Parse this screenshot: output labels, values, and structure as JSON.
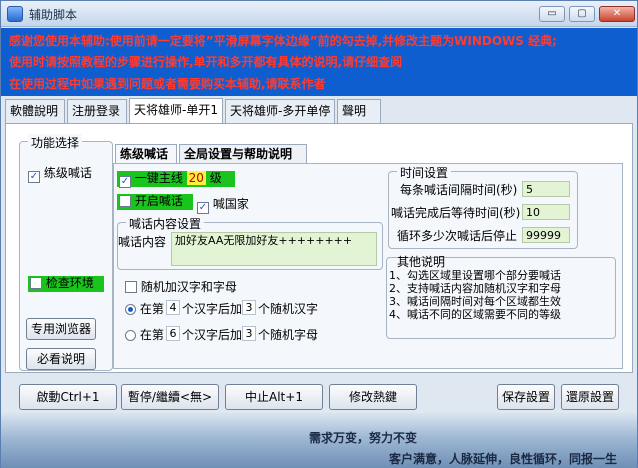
{
  "window": {
    "title": "辅助脚本",
    "controls": {
      "minimize": "▭",
      "restore": "▢",
      "close": "✕"
    }
  },
  "notice": {
    "lines": [
      "感谢您使用本辅助:使用前请一定要将”平滑屏幕字体边缘”前的勾去掉,并修改主题为WINDOWS 经典;",
      "使用时请按照教程的步骤进行操作,单开和多开都有具体的说明,请仔细查阅",
      "在使用过程中如果遇到问题或者需要购买本辅助,请联系作者"
    ],
    "color": "#ff3b2f",
    "background": "#0f5ed0"
  },
  "tabs": [
    "軟體說明",
    "注册登录",
    "天将雄师-单开1",
    "天将雄师-多开单停",
    "聲明"
  ],
  "active_tab": 2,
  "feature_panel": {
    "title": "功能选择",
    "shout_check": {
      "label": "练级喊话",
      "checked": true
    },
    "check_env": {
      "label": "检查环境",
      "checked": false
    },
    "browser_button": "专用浏览器",
    "readme_button": "必看说明"
  },
  "sub_tabs": [
    "练级喊话",
    "全局设置与帮助说明"
  ],
  "left": {
    "main_line": {
      "label": "一键主线",
      "level": "20",
      "unit": "级",
      "checked": true
    },
    "open_shout": {
      "label": "开启喊话",
      "checked": false
    },
    "country_shout": {
      "label": "喊国家",
      "checked": true
    },
    "content_group": "喊话内容设置",
    "content_label": "喊话内容",
    "content_value": "加好友AA无限加好友++++++++",
    "random_check": {
      "label": "随机加汉字和字母",
      "checked": false
    },
    "radio1": {
      "prefix": "在第",
      "n1": "4",
      "mid": "个汉字后加",
      "n2": "3",
      "suffix": "个随机汉字",
      "selected": true
    },
    "radio2": {
      "prefix": "在第",
      "n1": "6",
      "mid": "个汉字后加",
      "n2": "3",
      "suffix": "个随机字母",
      "selected": false
    }
  },
  "time": {
    "title": "时间设置",
    "rows": [
      {
        "label": "每条喊话间隔时间(秒)",
        "value": "5"
      },
      {
        "label": "喊话完成后等待时间(秒)",
        "value": "10"
      },
      {
        "label": "循环多少次喊话后停止",
        "value": "99999"
      }
    ]
  },
  "notes": {
    "title": "其他说明",
    "lines": [
      "1、勾选区域里设置哪个部分要喊话",
      "2、支持喊话内容加随机汉字和字母",
      "3、喊话间隔时间对每个区域都生效",
      "4、喊话不同的区域需要不同的等级"
    ]
  },
  "buttons": {
    "start": "啟動Ctrl+1",
    "pause": "暫停/繼續<無>",
    "stop": "中止Alt+1",
    "modify_hotkey": "修改熱鍵",
    "save": "保存設置",
    "restore": "還原設置"
  },
  "footer": {
    "line1": "需求万变，努力不变",
    "line2": "客户满意，人脉延伸，良性循环，同报一生"
  }
}
